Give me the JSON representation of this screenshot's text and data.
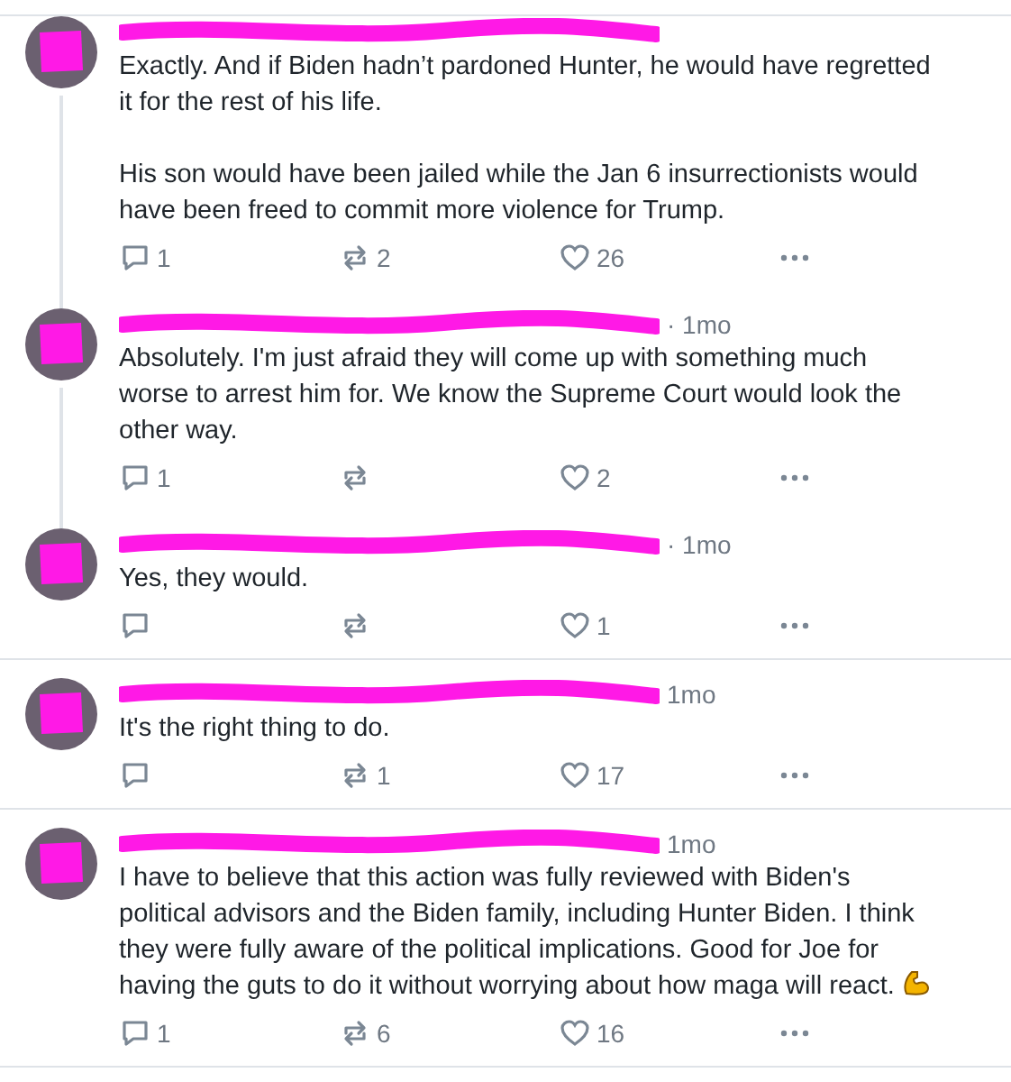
{
  "posts": [
    {
      "thread_line": true,
      "body": [
        "Exactly. And if Biden hadn’t pardoned Hunter, he would have regretted it for the rest of his life.",
        "His son would have been jailed while the Jan 6 insurrectionists would have been freed to commit more violence for Trump."
      ],
      "replies": "1",
      "reposts": "2",
      "likes": "26"
    },
    {
      "thread_line": true,
      "time": "· 1mo",
      "body": [
        "Absolutely. I'm just afraid they will come up with something much worse to arrest him for. We know the Supreme Court would look the other way."
      ],
      "replies": "1",
      "likes": "2"
    },
    {
      "thread_line": false,
      "time": "· 1mo",
      "body": [
        "Yes, they would."
      ],
      "likes": "1"
    },
    {
      "thread_line": false,
      "time": "1mo",
      "body": [
        "It's the right thing to do."
      ],
      "reposts": "1",
      "likes": "17"
    },
    {
      "thread_line": false,
      "time": "1mo",
      "body": [
        "I have to believe that this action was fully reviewed with Biden's political advisors and the Biden family, including Hunter Biden. I think they were fully aware of the political implications. Good for Joe for having the guts to do it without worrying about how maga will react."
      ],
      "flexed_biceps": true,
      "replies": "1",
      "reposts": "6",
      "likes": "16"
    }
  ]
}
